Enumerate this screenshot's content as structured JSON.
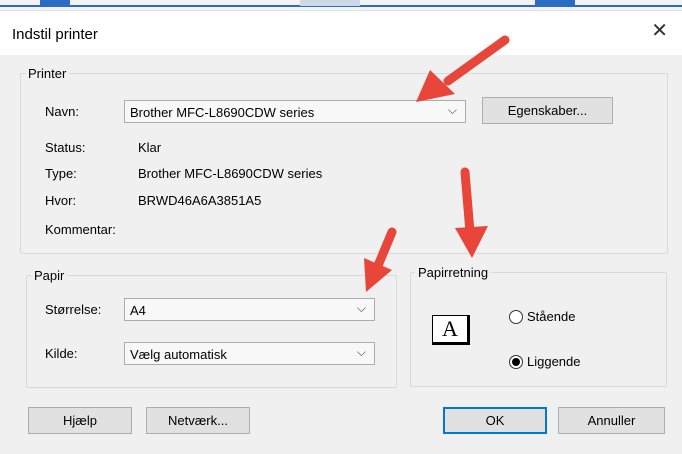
{
  "window": {
    "title": "Indstil printer",
    "close_glyph": "✕"
  },
  "printer": {
    "legend": "Printer",
    "name_label": "Navn:",
    "name_value": "Brother MFC-L8690CDW series",
    "properties_button": "Egenskaber...",
    "status_label": "Status:",
    "status_value": "Klar",
    "type_label": "Type:",
    "type_value": "Brother MFC-L8690CDW series",
    "where_label": "Hvor:",
    "where_value": "BRWD46A6A3851A5",
    "comment_label": "Kommentar:"
  },
  "paper": {
    "legend": "Papir",
    "size_label": "Størrelse:",
    "size_value": "A4",
    "source_label": "Kilde:",
    "source_value": "Vælg automatisk"
  },
  "orientation": {
    "legend": "Papirretning",
    "icon_letter": "A",
    "portrait_label": "Stående",
    "landscape_label": "Liggende",
    "selected": "Liggende"
  },
  "buttons": {
    "help": "Hjælp",
    "network": "Netværk...",
    "ok": "OK",
    "cancel": "Annuller"
  },
  "colors": {
    "arrow": "#e8463a",
    "accent": "#0078d7"
  }
}
